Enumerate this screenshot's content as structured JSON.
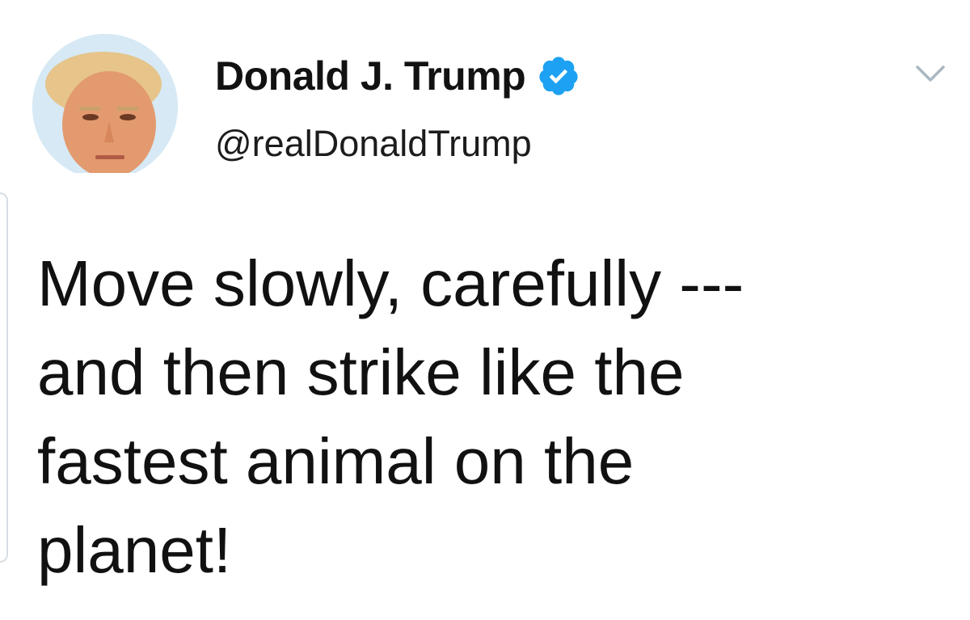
{
  "tweet": {
    "author": {
      "display_name": "Donald J. Trump",
      "handle": "@realDonaldTrump",
      "verified": true,
      "avatar_icon": "profile-photo"
    },
    "text_lines": [
      "Move slowly, carefully ---",
      "and then strike like the",
      "fastest animal on the",
      "planet!"
    ],
    "menu_icon": "chevron-down-icon"
  },
  "colors": {
    "verified_badge": "#1da1f2",
    "text": "#111111",
    "caret": "#aab8c2"
  }
}
